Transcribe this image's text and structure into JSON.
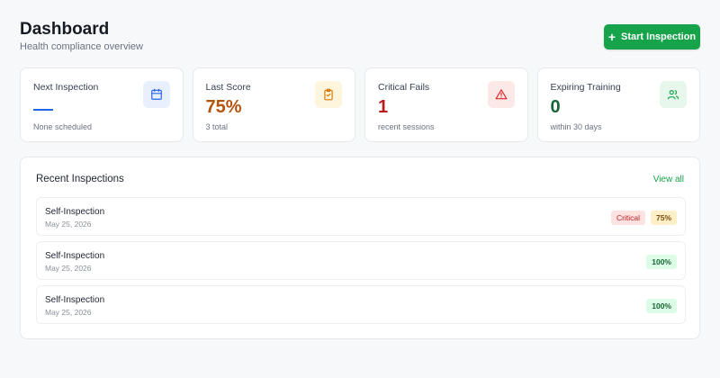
{
  "header": {
    "title": "Dashboard",
    "subtitle": "Health compliance overview",
    "start_button_label": "Start Inspection"
  },
  "cards": [
    {
      "label": "Next Inspection",
      "value": "",
      "sub": "None scheduled",
      "icon": "calendar-icon",
      "value_color": "#2563eb",
      "icon_bg": "#e8f0fe",
      "icon_color": "#2563eb"
    },
    {
      "label": "Last Score",
      "value": "75%",
      "sub": "3 total",
      "icon": "clipboard-check-icon",
      "value_color": "#b45309",
      "icon_bg": "#fef6dc",
      "icon_color": "#d97706"
    },
    {
      "label": "Critical Fails",
      "value": "1",
      "sub": "recent sessions",
      "icon": "warning-triangle-icon",
      "value_color": "#b91c1c",
      "icon_bg": "#fde8e8",
      "icon_color": "#dc2626"
    },
    {
      "label": "Expiring Training",
      "value": "0",
      "sub": "within 30 days",
      "icon": "users-icon",
      "value_color": "#166534",
      "icon_bg": "#e7f7ec",
      "icon_color": "#16a34a"
    }
  ],
  "recent": {
    "title": "Recent Inspections",
    "view_all_label": "View all",
    "items": [
      {
        "name": "Self-Inspection",
        "date": "May 25, 2026",
        "critical_badge": "Critical",
        "score": "75%"
      },
      {
        "name": "Self-Inspection",
        "date": "May 25, 2026",
        "score": "100%"
      },
      {
        "name": "Self-Inspection",
        "date": "May 25, 2026",
        "score": "100%"
      }
    ]
  },
  "colors": {
    "accent": "#16a34a",
    "background": "#f7f8fa"
  }
}
